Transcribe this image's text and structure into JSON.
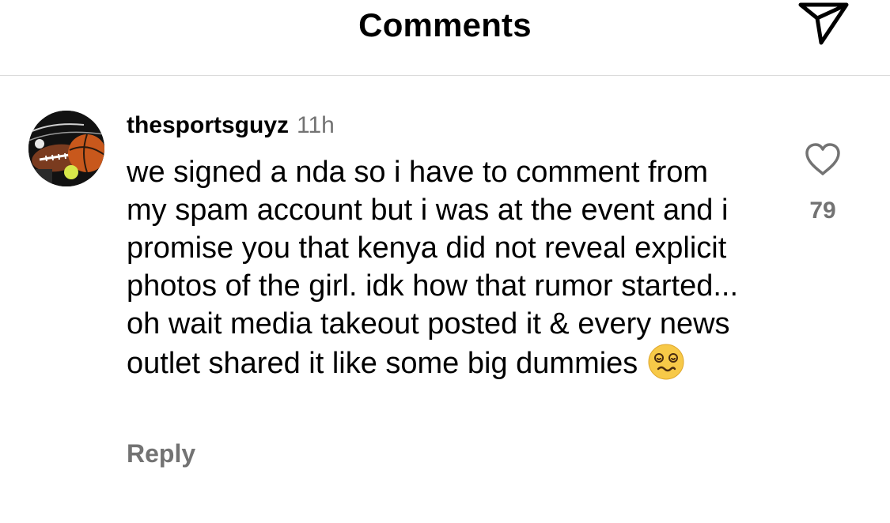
{
  "header": {
    "title": "Comments",
    "share_icon": "send-icon"
  },
  "comment": {
    "username": "thesportsguyz",
    "time": "11h",
    "text": "we signed a nda so i have to comment from my spam account but i was at the event and i promise you that kenya did not reveal explicit photos of the girl. idk how that rumor started... oh wait media takeout posted it & every news outlet shared it like some big dummies",
    "emoji": "dizzy-face-emoji",
    "reply_label": "Reply",
    "like_icon": "heart-icon",
    "like_count": "79",
    "avatar": "sports-balls-avatar"
  }
}
